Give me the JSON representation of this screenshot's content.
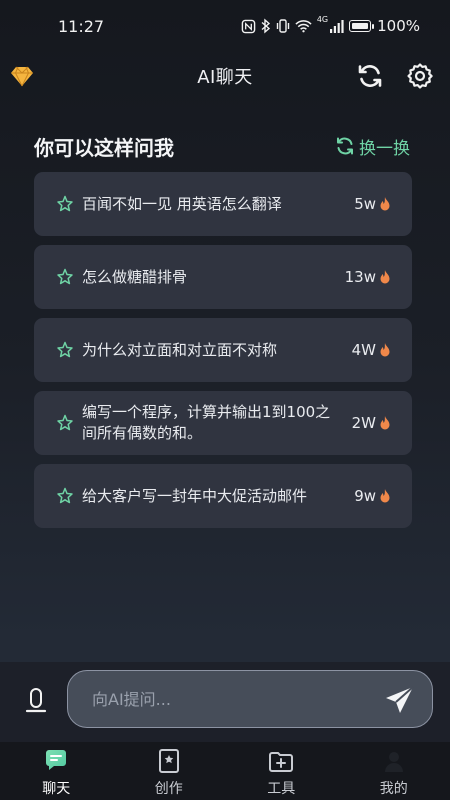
{
  "status_bar": {
    "time": "11:27",
    "network": "4G",
    "battery": "100%"
  },
  "header": {
    "title": "AI聊天",
    "icons": [
      "diamond-icon",
      "refresh-icon",
      "gear-icon"
    ]
  },
  "suggestions": {
    "title": "你可以这样问我",
    "swap_label": "换一换",
    "items": [
      {
        "text": "百闻不如一见 用英语怎么翻译",
        "count": "5w"
      },
      {
        "text": "怎么做糖醋排骨",
        "count": "13w"
      },
      {
        "text": "为什么对立面和对立面不对称",
        "count": "4W"
      },
      {
        "text": "编写一个程序，计算并输出1到100之间所有偶数的和。",
        "count": "2W"
      },
      {
        "text": "给大客户写一封年中大促活动邮件",
        "count": "9w"
      }
    ]
  },
  "input": {
    "placeholder": "向AI提问..."
  },
  "tabs": [
    {
      "label": "聊天",
      "icon": "chat-icon",
      "active": true
    },
    {
      "label": "创作",
      "icon": "bookmark-star-icon",
      "active": false
    },
    {
      "label": "工具",
      "icon": "toolbox-icon",
      "active": false
    },
    {
      "label": "我的",
      "icon": "user-icon",
      "active": false
    }
  ],
  "colors": {
    "accent_green": "#6fd3a5",
    "fire": "#f0884a",
    "diamond": "#f5b53f"
  }
}
